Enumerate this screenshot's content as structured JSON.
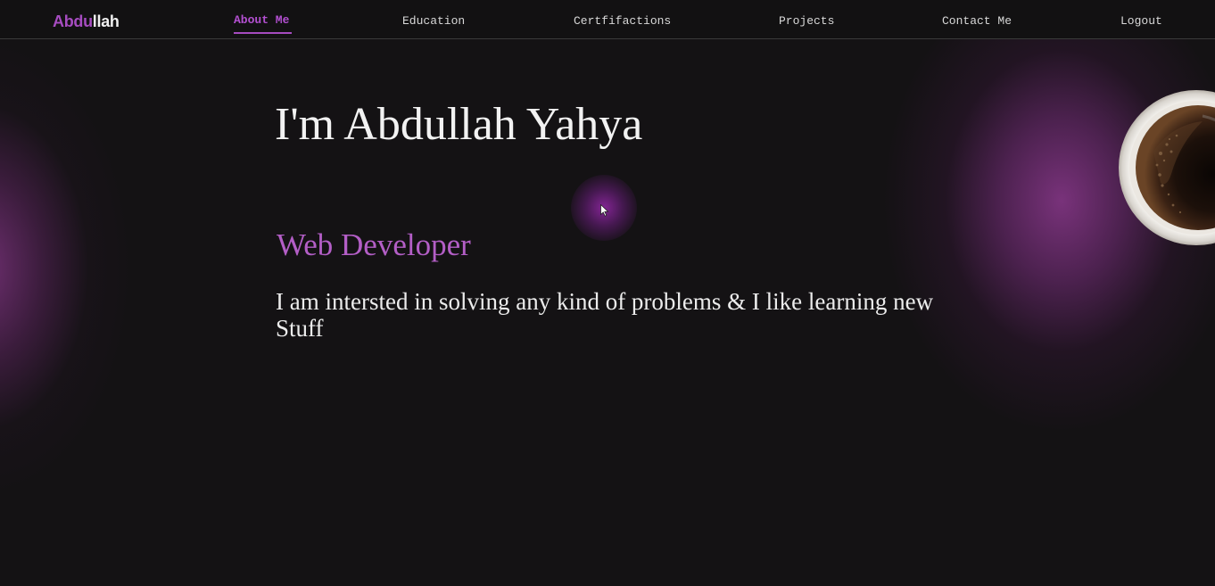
{
  "logo": {
    "part1": "Abdu",
    "part2": "llah"
  },
  "nav": {
    "items": [
      {
        "label": "About Me",
        "active": true
      },
      {
        "label": "Education",
        "active": false
      },
      {
        "label": "Certfifactions",
        "active": false
      },
      {
        "label": "Projects",
        "active": false
      },
      {
        "label": "Contact Me",
        "active": false
      },
      {
        "label": "Logout",
        "active": false
      }
    ]
  },
  "hero": {
    "title": "I'm Abdullah Yahya",
    "subtitle": "Web Developer",
    "description": "I am intersted in solving any kind of problems & I like learning new Stuff"
  },
  "colors": {
    "accent": "#a64cc0",
    "background": "#141214",
    "text": "#f2f2f2",
    "glow": "#7e3480"
  },
  "icons": {
    "cursor": "mouse-cursor-icon",
    "coffee": "coffee-cup-image"
  }
}
